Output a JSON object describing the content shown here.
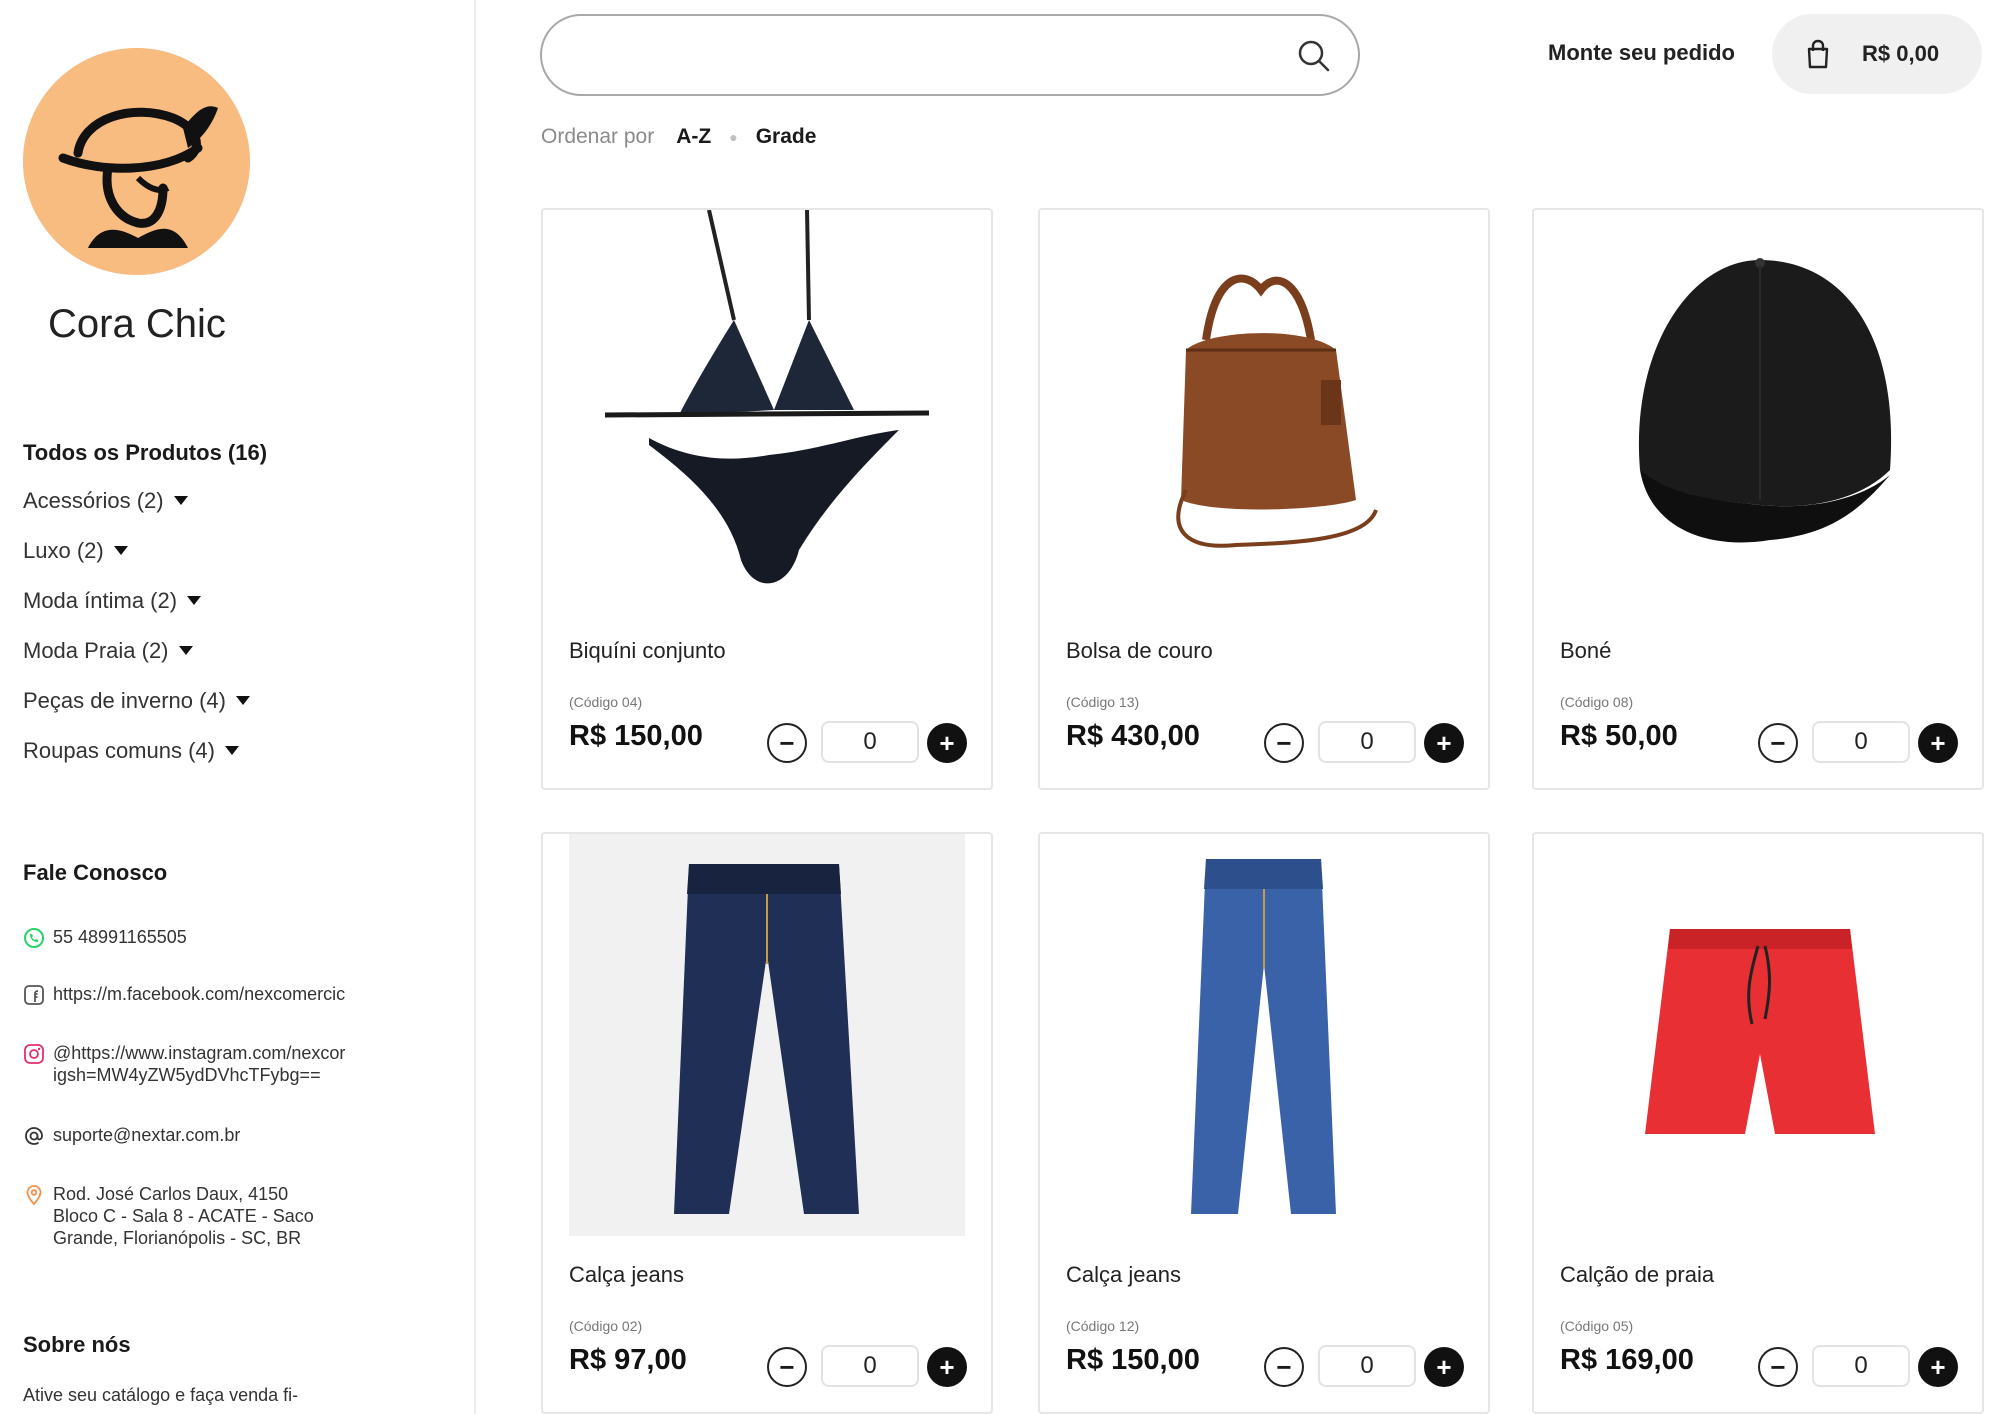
{
  "store": {
    "name": "Cora Chic"
  },
  "categories": {
    "all": "Todos os Produtos (16)",
    "items": [
      {
        "label": "Acessórios (2)"
      },
      {
        "label": "Luxo (2)"
      },
      {
        "label": "Moda íntima (2)"
      },
      {
        "label": "Moda Praia (2)"
      },
      {
        "label": "Peças de inverno (4)"
      },
      {
        "label": "Roupas comuns (4)"
      }
    ]
  },
  "contact": {
    "title": "Fale Conosco",
    "phone": "55 48991165505",
    "facebook": "https://m.facebook.com/nexcomercic",
    "instagram": "@https://www.instagram.com/nexcor\nigsh=MW4yZW5ydDVhcTFybg==",
    "email": "suporte@nextar.com.br",
    "address": "Rod. José Carlos Daux, 4150\nBloco C - Sala 8 - ACATE - Saco\nGrande, Florianópolis - SC, BR"
  },
  "about": {
    "title": "Sobre nós",
    "text": "Ative seu catálogo e faça venda fi-"
  },
  "header": {
    "search_placeholder": "",
    "order_link": "Monte seu pedido",
    "cart_total": "R$ 0,00"
  },
  "sort": {
    "label": "Ordenar por",
    "value": "A-Z",
    "view": "Grade"
  },
  "products": [
    {
      "name": "Biquíni conjunto",
      "code": "(Código 04)",
      "price": "R$ 150,00",
      "qty": "0",
      "icon": "bikini"
    },
    {
      "name": "Bolsa de couro",
      "code": "(Código 13)",
      "price": "R$ 430,00",
      "qty": "0",
      "icon": "handbag"
    },
    {
      "name": "Boné",
      "code": "(Código 08)",
      "price": "R$ 50,00",
      "qty": "0",
      "icon": "cap"
    },
    {
      "name": "Calça jeans",
      "code": "(Código 02)",
      "price": "R$ 97,00",
      "qty": "0",
      "icon": "jeans-dark"
    },
    {
      "name": "Calça jeans",
      "code": "(Código 12)",
      "price": "R$ 150,00",
      "qty": "0",
      "icon": "jeans-light"
    },
    {
      "name": "Calção de praia",
      "code": "(Código 05)",
      "price": "R$ 169,00",
      "qty": "0",
      "icon": "swim-shorts"
    }
  ],
  "colors": {
    "logo_bg": "#f8bb80",
    "plus_button": "#111111",
    "whatsapp": "#25d366",
    "instagram": "#e1306c",
    "location": "#f0914a"
  }
}
